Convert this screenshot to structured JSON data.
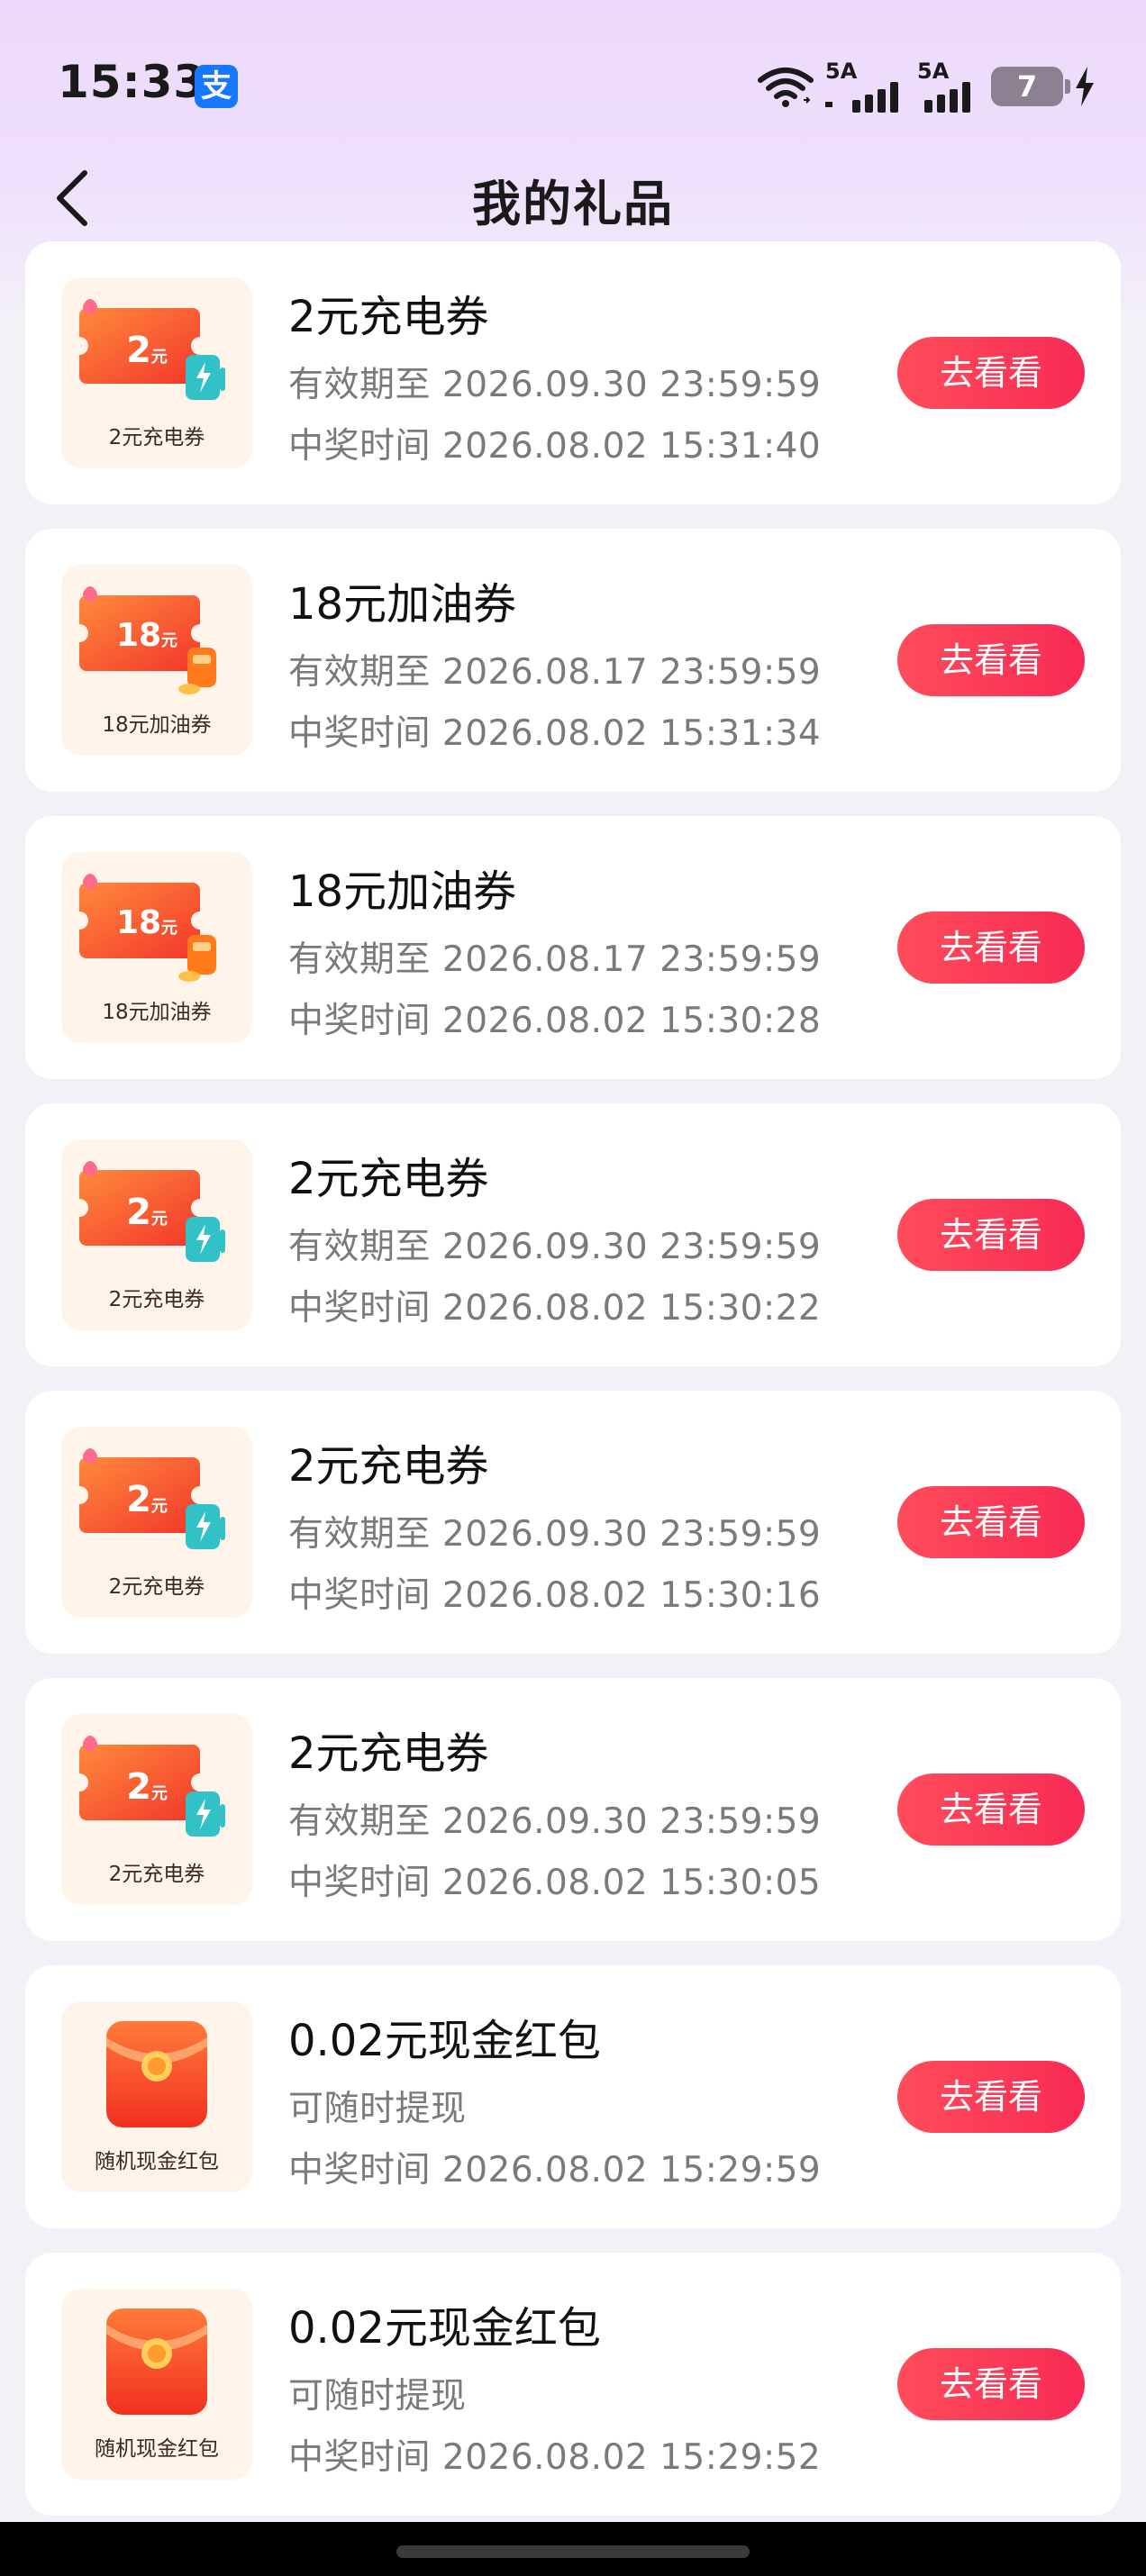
{
  "status": {
    "time": "15:33",
    "app_badge": "支",
    "net1": "5A",
    "net2": "5A",
    "battery": "7"
  },
  "header": {
    "title": "我的礼品"
  },
  "colors": {
    "accent": "#f7365a",
    "coupon": "#ff5a3c",
    "charge_icon": "#33c1c8",
    "fuel_icon": "#ff7a1a"
  },
  "gifts": [
    {
      "kind": "charge",
      "thumb_amount": "2",
      "thumb_unit": "元",
      "thumb_caption": "2元充电券",
      "title": "2元充电券",
      "line1": "有效期至 2026.09.30 23:59:59",
      "line2": "中奖时间 2026.08.02 15:31:40",
      "button": "去看看"
    },
    {
      "kind": "fuel",
      "thumb_amount": "18",
      "thumb_unit": "元",
      "thumb_caption": "18元加油券",
      "title": "18元加油券",
      "line1": "有效期至 2026.08.17 23:59:59",
      "line2": "中奖时间 2026.08.02 15:31:34",
      "button": "去看看"
    },
    {
      "kind": "fuel",
      "thumb_amount": "18",
      "thumb_unit": "元",
      "thumb_caption": "18元加油券",
      "title": "18元加油券",
      "line1": "有效期至 2026.08.17 23:59:59",
      "line2": "中奖时间 2026.08.02 15:30:28",
      "button": "去看看"
    },
    {
      "kind": "charge",
      "thumb_amount": "2",
      "thumb_unit": "元",
      "thumb_caption": "2元充电券",
      "title": "2元充电券",
      "line1": "有效期至 2026.09.30 23:59:59",
      "line2": "中奖时间 2026.08.02 15:30:22",
      "button": "去看看"
    },
    {
      "kind": "charge",
      "thumb_amount": "2",
      "thumb_unit": "元",
      "thumb_caption": "2元充电券",
      "title": "2元充电券",
      "line1": "有效期至 2026.09.30 23:59:59",
      "line2": "中奖时间 2026.08.02 15:30:16",
      "button": "去看看"
    },
    {
      "kind": "charge",
      "thumb_amount": "2",
      "thumb_unit": "元",
      "thumb_caption": "2元充电券",
      "title": "2元充电券",
      "line1": "有效期至 2026.09.30 23:59:59",
      "line2": "中奖时间 2026.08.02 15:30:05",
      "button": "去看看"
    },
    {
      "kind": "redpacket",
      "thumb_amount": "",
      "thumb_unit": "",
      "thumb_caption": "随机现金红包",
      "title": "0.02元现金红包",
      "line1": "可随时提现",
      "line2": "中奖时间 2026.08.02 15:29:59",
      "button": "去看看"
    },
    {
      "kind": "redpacket",
      "thumb_amount": "",
      "thumb_unit": "",
      "thumb_caption": "随机现金红包",
      "title": "0.02元现金红包",
      "line1": "可随时提现",
      "line2": "中奖时间 2026.08.02 15:29:52",
      "button": "去看看"
    }
  ]
}
